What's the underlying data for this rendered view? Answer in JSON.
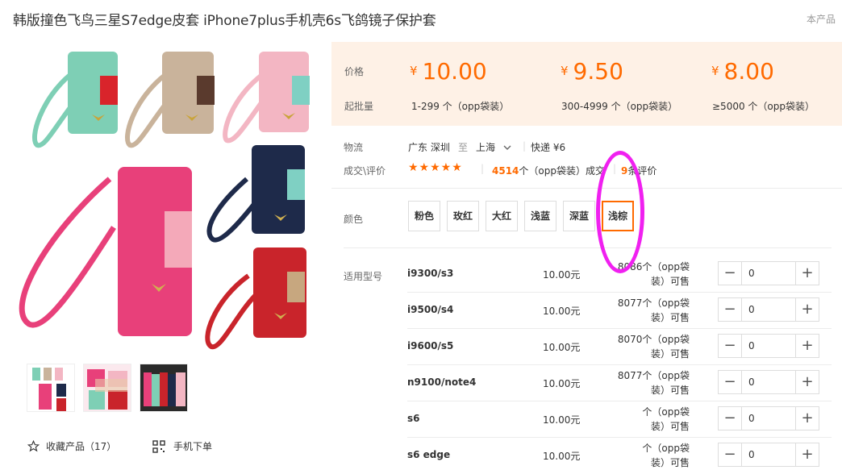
{
  "title": "韩版撞色飞鸟三星S7edge皮套 iPhone7plus手机壳6s飞鸽镜子保护套",
  "cut_text": "本产品",
  "price_label": "价格",
  "moq_label": "起批量",
  "tiers": [
    {
      "currency": "¥",
      "price": "10.00",
      "range": "1-299 个（opp袋装）"
    },
    {
      "currency": "¥",
      "price": "9.50",
      "range": "300-4999 个（opp袋装）"
    },
    {
      "currency": "¥",
      "price": "8.00",
      "range": "≥5000 个（opp袋装）"
    }
  ],
  "logistics": {
    "label": "物流",
    "from": "广东 深圳",
    "to_word": "至",
    "to": "上海",
    "express": "快递 ¥6"
  },
  "deals": {
    "label": "成交\\评价",
    "rating": 5,
    "count": "4514",
    "count_suffix": "个（opp袋装）成交",
    "reviews": "9",
    "reviews_suffix": "条评价"
  },
  "color_label": "颜色",
  "colors": [
    "粉色",
    "玫红",
    "大红",
    "浅蓝",
    "深蓝",
    "浅棕"
  ],
  "selected_color": "浅棕",
  "model_label": "适用型号",
  "models": [
    {
      "name": "i9300/s3",
      "price": "10.00元",
      "stock1": "8086个（opp袋",
      "stock2": "装）可售",
      "qty": "0"
    },
    {
      "name": "i9500/s4",
      "price": "10.00元",
      "stock1": "8077个（opp袋",
      "stock2": "装）可售",
      "qty": "0"
    },
    {
      "name": "i9600/s5",
      "price": "10.00元",
      "stock1": "8070个（opp袋",
      "stock2": "装）可售",
      "qty": "0"
    },
    {
      "name": "n9100/note4",
      "price": "10.00元",
      "stock1": "8077个（opp袋",
      "stock2": "装）可售",
      "qty": "0"
    },
    {
      "name": "s6",
      "price": "10.00元",
      "stock1": "个（opp袋",
      "stock2": "装）可售",
      "qty": "0"
    },
    {
      "name": "s6 edge",
      "price": "10.00元",
      "stock1": "个（opp袋",
      "stock2": "装）可售",
      "qty": "0"
    }
  ],
  "favorite": "收藏产品（17）",
  "mobile_order": "手机下单",
  "icons": {
    "star": "star-outline-icon",
    "qr": "qr-code-icon",
    "chevron": "chevron-down-icon"
  },
  "colors_hex": {
    "accent": "#ff6a00",
    "price_bg": "#fef1e6",
    "annotation": "#f020f0"
  }
}
